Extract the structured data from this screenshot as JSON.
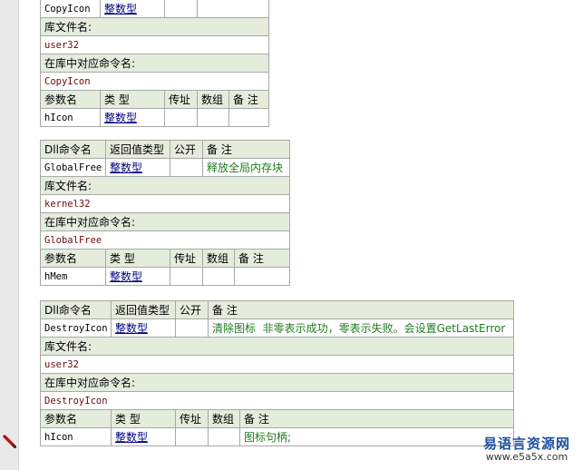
{
  "labels": {
    "dll_name": "Dll命令名",
    "return_type": "返回值类型",
    "public": "公开",
    "remark": "备 注",
    "lib_file": "库文件名:",
    "lib_cmd": "在库中对应命令名:",
    "param_name": "参数名",
    "type": "类 型",
    "byref": "传址",
    "array": "数组"
  },
  "block1": {
    "name": "CopyIcon",
    "return_type": "整数型",
    "lib_file": "user32",
    "lib_cmd": "CopyIcon",
    "param": {
      "name": "hIcon",
      "type": "整数型"
    }
  },
  "block2": {
    "name": "GlobalFree",
    "return_type": "整数型",
    "remark": "释放全局内存块",
    "lib_file": "kernel32",
    "lib_cmd": "GlobalFree",
    "param": {
      "name": "hMem",
      "type": "整数型"
    }
  },
  "block3": {
    "name": "DestroyIcon",
    "return_type": "整数型",
    "remark": "清除图标  非零表示成功，零表示失败。会设置GetLastError",
    "lib_file": "user32",
    "lib_cmd": "DestroyIcon",
    "param": {
      "name": "hIcon",
      "type": "整数型",
      "remark": "图标句柄;"
    }
  },
  "watermark": {
    "line1": "易语言资源网",
    "line2": "www.e5a5x.com"
  },
  "icons": {
    "gutter_marker": "pencil-icon"
  },
  "colors": {
    "header_bg": "#e4ecdc",
    "type_link": "#000080",
    "remark": "#1f7a1f",
    "value": "#6b0a0a",
    "border": "#a8a8a8"
  }
}
